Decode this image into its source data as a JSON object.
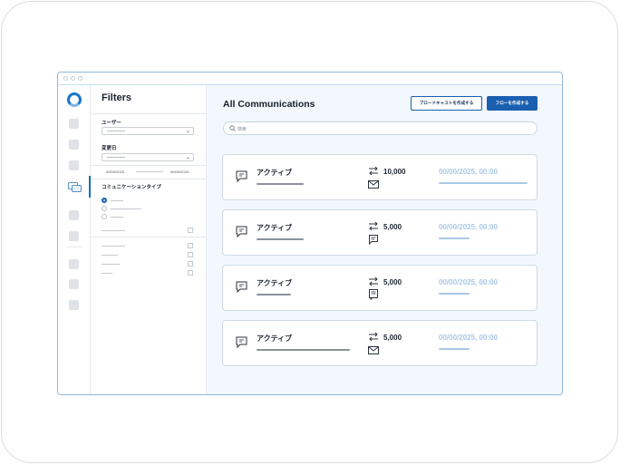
{
  "sidebar": {
    "filters_title": "Filters",
    "user_label": "ユーザー",
    "modified_label": "変更日",
    "date_from": "00/00/2025",
    "date_to": "00/00/2025",
    "comm_type_label": "コミュニケーションタイプ"
  },
  "header": {
    "title": "All Communications",
    "broadcast_button": "ブロードキャストを作成する",
    "flow_button": "フローを作成する"
  },
  "search": {
    "placeholder": "検索"
  },
  "rows": [
    {
      "status": "アクティブ",
      "count": "10,000",
      "date": "00/00/2025, 00:00",
      "channel_icon": "mail-icon"
    },
    {
      "status": "アクティブ",
      "count": "5,000",
      "date": "00/00/2025, 00:00",
      "channel_icon": "sms-icon"
    },
    {
      "status": "アクティブ",
      "count": "5,000",
      "date": "00/00/2025, 00:00",
      "channel_icon": "form-icon"
    },
    {
      "status": "アクティブ",
      "count": "5,000",
      "date": "00/00/2025, 00:00",
      "channel_icon": "mail-icon"
    }
  ],
  "colors": {
    "accent": "#1a5fb0",
    "date_text": "#a9c7e6",
    "main_bg": "#f2f8fd"
  }
}
